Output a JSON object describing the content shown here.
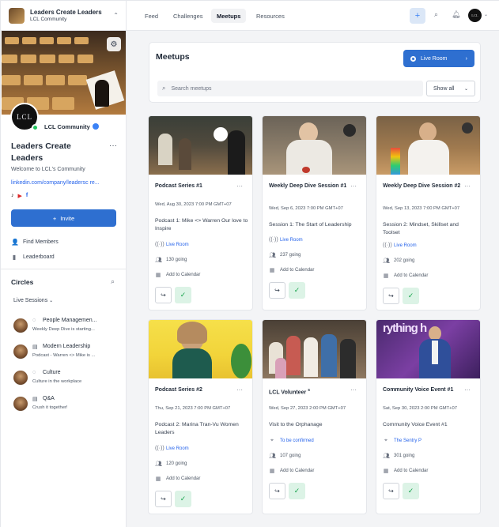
{
  "sidebar": {
    "community_name": "Leaders Create Leaders",
    "community_sub": "LCL Community",
    "avatar_text": "LCL",
    "badge_name": "LCL Community",
    "title": "Leaders Create Leaders",
    "welcome": "Welcome to LCL's Community",
    "link": "linkedin.com/company/leadersc re...",
    "invite_label": "Invite",
    "find_members": "Find Members",
    "leaderboard": "Leaderboard",
    "circles_heading": "Circles",
    "circles_filter": "Live Sessions",
    "circles": [
      {
        "name": "People Managemen...",
        "desc": "Weekly Deep Dive is starting..."
      },
      {
        "name": "Modern Leadership",
        "desc": "Podcast - Warren <> Mike is ..."
      },
      {
        "name": "Culture",
        "desc": "Culture in the workplace"
      },
      {
        "name": "Q&A",
        "desc": "Crush it together!"
      }
    ]
  },
  "topnav": {
    "tabs": [
      "Feed",
      "Challenges",
      "Meetups",
      "Resources"
    ],
    "active_tab": "Meetups",
    "avatar_text": "LCL"
  },
  "meetups": {
    "title": "Meetups",
    "live_button": "Live Room",
    "search_placeholder": "Search meetups",
    "filter": "Show all",
    "cards": [
      {
        "title": "Podcast Series #1",
        "date": "Wed, Aug 30, 2023 7:00 PM GMT+07",
        "desc": "Podcast 1: Mike <> Warren Our love to Inspire",
        "location": "Live Room",
        "going": "130 going",
        "calendar": "Add to Calendar"
      },
      {
        "title": "Weekly Deep Dive Session #1",
        "date": "Wed, Sep 6, 2023 7:00 PM GMT+07",
        "desc": "Session 1: The Start of Leadership",
        "location": "Live Room",
        "going": "237 going",
        "calendar": "Add to Calendar"
      },
      {
        "title": "Weekly Deep Dive Session #2",
        "date": "Wed, Sep 13, 2023 7:00 PM GMT+07",
        "desc": "Session 2: Mindset, Skillset and Toolset",
        "location": "Live Room",
        "going": "202 going",
        "calendar": "Add to Calendar"
      },
      {
        "title": "Podcast Series #2",
        "date": "Thu, Sep 21, 2023 7:00 PM GMT+07",
        "desc": "Podcast 2: Marina Tran-Vu Women Leaders",
        "location": "Live Room",
        "going": "120 going",
        "calendar": "Add to Calendar"
      },
      {
        "title": "LCL Volunteer",
        "date": "Wed, Sep 27, 2023 2:00 PM GMT+07",
        "desc": "Visit to the Orphanage",
        "location": "To be confirmed",
        "going": "107 going",
        "calendar": "Add to Calendar"
      },
      {
        "title": "Community Voice Event #1",
        "date": "Sat, Sep 30, 2023 2:00 PM GMT+07",
        "desc": "Community Voice Event #1",
        "location": "The Sentry P",
        "going": "301 going",
        "calendar": "Add to Calendar"
      }
    ]
  },
  "colors": {
    "accent": "#2e6fd0",
    "live": "#2563eb",
    "check_bg": "#dcf3e6",
    "check": "#16a34a"
  }
}
